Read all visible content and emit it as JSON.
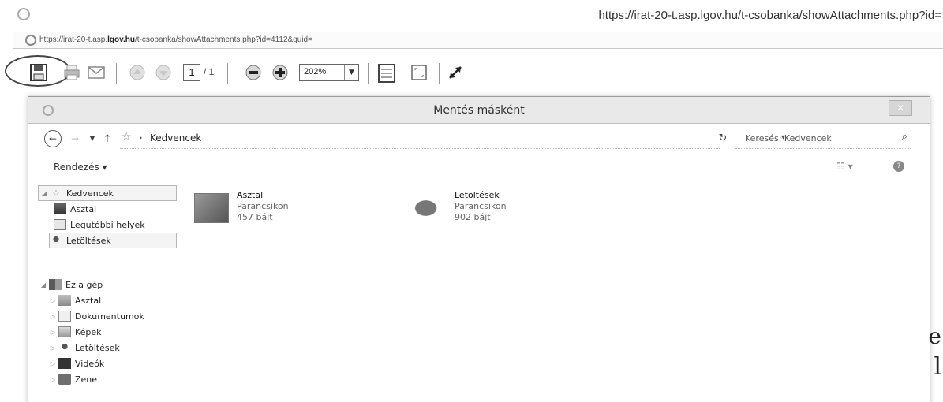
{
  "browser": {
    "title_url": "https://irat-20-t.asp.lgov.hu/t-csobanka/showAttachments.php?id=",
    "address_prefix": "https://irat-20-t.asp.",
    "address_domain": "lgov.hu",
    "address_path": "/t-csobanka/showAttachments.php?id=4112&guid="
  },
  "pdf_toolbar": {
    "page_current": "1",
    "page_total": "/ 1",
    "zoom_value": "202%"
  },
  "dialog": {
    "title": "Mentés másként",
    "close_glyph": "✕",
    "breadcrumb_location": "Kedvencek",
    "search_placeholder": "Keresés: Kedvencek",
    "organize_label": "Rendezés ▾",
    "nav_pane": [
      {
        "label": "Kedvencek",
        "icon": "star-icon"
      },
      {
        "label": "Asztal",
        "icon": "desktop-icon"
      },
      {
        "label": "Legutóbbi helyek",
        "icon": "recent-places-icon"
      },
      {
        "label": "Letöltések",
        "icon": "downloads-icon"
      },
      {
        "label": "Ez a gép",
        "icon": "computer-icon"
      },
      {
        "label": "Asztal",
        "icon": "desktop-icon"
      },
      {
        "label": "Dokumentumok",
        "icon": "documents-icon"
      },
      {
        "label": "Képek",
        "icon": "pictures-icon"
      },
      {
        "label": "Letöltések",
        "icon": "downloads-icon"
      },
      {
        "label": "Videók",
        "icon": "videos-icon"
      },
      {
        "label": "Zene",
        "icon": "music-icon"
      }
    ],
    "files": [
      {
        "name": "Asztal",
        "type": "Parancsikon",
        "size": "457 bájt"
      },
      {
        "name": "Letöltések",
        "type": "Parancsikon",
        "size": "902 bájt"
      }
    ]
  },
  "background_text": [
    "e",
    "l"
  ]
}
